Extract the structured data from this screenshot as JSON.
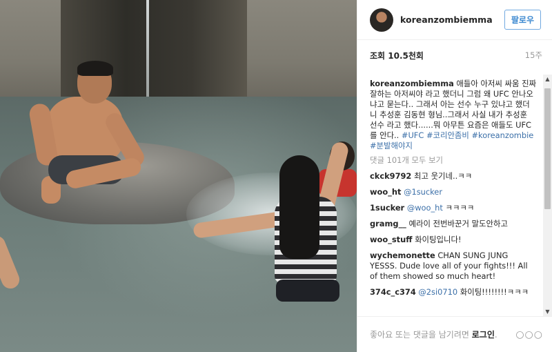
{
  "post": {
    "username": "koreanzombiemma",
    "follow_label": "팔로우",
    "views": "조회 10.5천회",
    "age": "15주"
  },
  "caption": {
    "username": "koreanzombiemma",
    "text": " 애들아 아저씨 싸움 진짜 잘하는 아저씨야 라고 했더니 그럼 왜 UFC 안나오냐고 묻는다.. 그래서 아는 선수 누구 있냐고 했더니 추성훈 김동현 형님..그래서 사실 내가 추성훈 선수 라고 했다......뭐 아무튼 요즘은 애들도 UFC를 안다.. ",
    "tags": [
      "#UFC",
      "#코리안좀비",
      "#koreanzombie",
      "#분발해야지"
    ]
  },
  "view_all_comments": "댓글 101개 모두 보기",
  "comments": [
    {
      "user": "ckck9792",
      "mention": "",
      "text": "최고 웃기네..ㅋㅋ"
    },
    {
      "user": "woo_ht",
      "mention": "@1sucker",
      "text": ""
    },
    {
      "user": "1sucker",
      "mention": "@woo_ht",
      "text": " ㅋㅋㅋㅋ"
    },
    {
      "user": "gramg__",
      "mention": "",
      "text": "예라이 전번바꾼거 말도안하고"
    },
    {
      "user": "woo_stuff",
      "mention": "",
      "text": "화이팅입니다!"
    },
    {
      "user": "wychemonette",
      "mention": "",
      "text": "CHAN SUNG JUNG YESSS. Dude love all of your fights!!! All of them showed so much heart!"
    },
    {
      "user": "374c_c374",
      "mention": "@2si0710",
      "text": " 화이팅!!!!!!!!ㅋㅋㅋ"
    }
  ],
  "footer": {
    "prompt": "좋아요 또는 댓글을 남기려면 ",
    "login": "로그인",
    "period": ".",
    "more": "○○○"
  },
  "icons": {
    "scroll_up": "▲",
    "scroll_down": "▼"
  }
}
